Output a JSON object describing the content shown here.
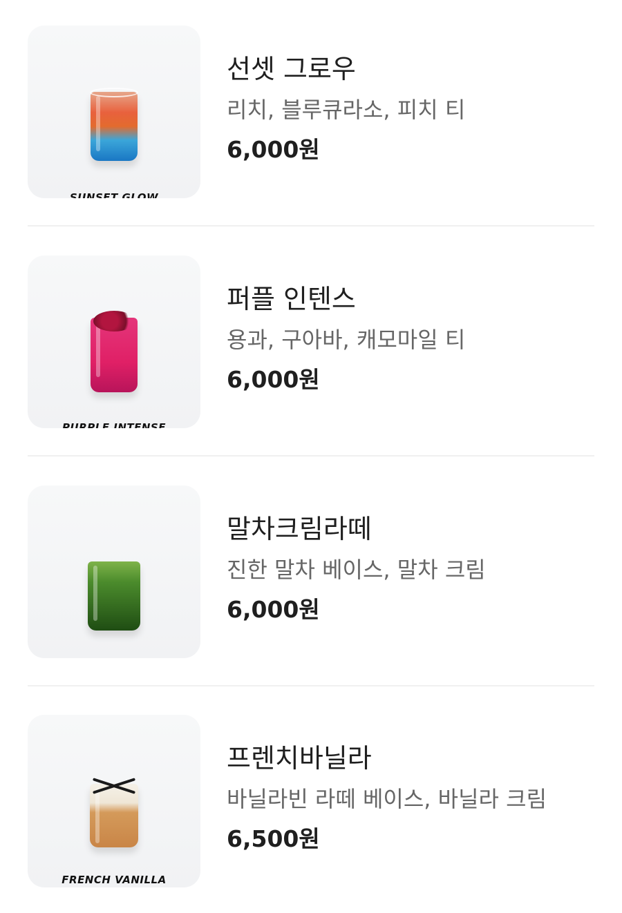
{
  "menu": {
    "items": [
      {
        "name": "선셋 그로우",
        "description": "리치, 블루큐라소, 피치 티",
        "price": "6,000원",
        "image_caption": "SUNSET GLOW"
      },
      {
        "name": "퍼플 인텐스",
        "description": "용과, 구아바, 캐모마일 티",
        "price": "6,000원",
        "image_caption": "PURPLE INTENSE"
      },
      {
        "name": "말차크림라떼",
        "description": "진한 말차 베이스, 말차 크림",
        "price": "6,000원"
      },
      {
        "name": "프렌치바닐라",
        "description": "바닐라빈 라떼 베이스, 바닐라 크림",
        "price": "6,500원",
        "image_caption": "FRENCH VANILLA"
      }
    ]
  },
  "colors": {
    "text_primary": "#1f1f1f",
    "text_secondary": "#666666",
    "divider": "#f0f0f0",
    "thumb_bg": "#f4f5f6"
  }
}
